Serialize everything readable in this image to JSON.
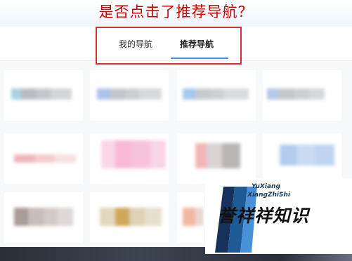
{
  "annotation": {
    "question": "是否点击了推荐导航？"
  },
  "tabs": [
    {
      "label": "我的导航",
      "active": false
    },
    {
      "label": "推荐导航",
      "active": true
    }
  ],
  "colors": {
    "accent": "#3b8fe3",
    "highlight_box": "#d8302f",
    "question_text": "#cc0000"
  },
  "watermark": {
    "pinyin_line1": "YuXiang",
    "pinyin_line2": "XiangZhiShi",
    "text": "誉祥祥知识"
  }
}
